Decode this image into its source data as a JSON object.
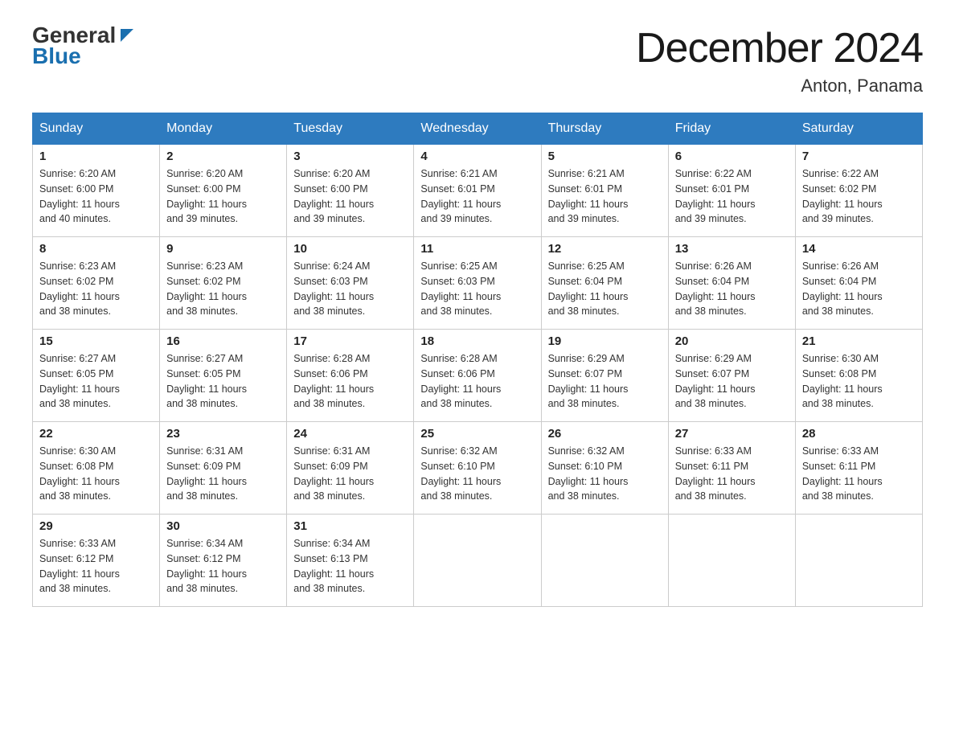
{
  "header": {
    "logo_general": "General",
    "logo_blue": "Blue",
    "month_title": "December 2024",
    "location": "Anton, Panama"
  },
  "days_of_week": [
    "Sunday",
    "Monday",
    "Tuesday",
    "Wednesday",
    "Thursday",
    "Friday",
    "Saturday"
  ],
  "weeks": [
    [
      {
        "day": "1",
        "sunrise": "6:20 AM",
        "sunset": "6:00 PM",
        "daylight": "11 hours and 40 minutes."
      },
      {
        "day": "2",
        "sunrise": "6:20 AM",
        "sunset": "6:00 PM",
        "daylight": "11 hours and 39 minutes."
      },
      {
        "day": "3",
        "sunrise": "6:20 AM",
        "sunset": "6:00 PM",
        "daylight": "11 hours and 39 minutes."
      },
      {
        "day": "4",
        "sunrise": "6:21 AM",
        "sunset": "6:01 PM",
        "daylight": "11 hours and 39 minutes."
      },
      {
        "day": "5",
        "sunrise": "6:21 AM",
        "sunset": "6:01 PM",
        "daylight": "11 hours and 39 minutes."
      },
      {
        "day": "6",
        "sunrise": "6:22 AM",
        "sunset": "6:01 PM",
        "daylight": "11 hours and 39 minutes."
      },
      {
        "day": "7",
        "sunrise": "6:22 AM",
        "sunset": "6:02 PM",
        "daylight": "11 hours and 39 minutes."
      }
    ],
    [
      {
        "day": "8",
        "sunrise": "6:23 AM",
        "sunset": "6:02 PM",
        "daylight": "11 hours and 38 minutes."
      },
      {
        "day": "9",
        "sunrise": "6:23 AM",
        "sunset": "6:02 PM",
        "daylight": "11 hours and 38 minutes."
      },
      {
        "day": "10",
        "sunrise": "6:24 AM",
        "sunset": "6:03 PM",
        "daylight": "11 hours and 38 minutes."
      },
      {
        "day": "11",
        "sunrise": "6:25 AM",
        "sunset": "6:03 PM",
        "daylight": "11 hours and 38 minutes."
      },
      {
        "day": "12",
        "sunrise": "6:25 AM",
        "sunset": "6:04 PM",
        "daylight": "11 hours and 38 minutes."
      },
      {
        "day": "13",
        "sunrise": "6:26 AM",
        "sunset": "6:04 PM",
        "daylight": "11 hours and 38 minutes."
      },
      {
        "day": "14",
        "sunrise": "6:26 AM",
        "sunset": "6:04 PM",
        "daylight": "11 hours and 38 minutes."
      }
    ],
    [
      {
        "day": "15",
        "sunrise": "6:27 AM",
        "sunset": "6:05 PM",
        "daylight": "11 hours and 38 minutes."
      },
      {
        "day": "16",
        "sunrise": "6:27 AM",
        "sunset": "6:05 PM",
        "daylight": "11 hours and 38 minutes."
      },
      {
        "day": "17",
        "sunrise": "6:28 AM",
        "sunset": "6:06 PM",
        "daylight": "11 hours and 38 minutes."
      },
      {
        "day": "18",
        "sunrise": "6:28 AM",
        "sunset": "6:06 PM",
        "daylight": "11 hours and 38 minutes."
      },
      {
        "day": "19",
        "sunrise": "6:29 AM",
        "sunset": "6:07 PM",
        "daylight": "11 hours and 38 minutes."
      },
      {
        "day": "20",
        "sunrise": "6:29 AM",
        "sunset": "6:07 PM",
        "daylight": "11 hours and 38 minutes."
      },
      {
        "day": "21",
        "sunrise": "6:30 AM",
        "sunset": "6:08 PM",
        "daylight": "11 hours and 38 minutes."
      }
    ],
    [
      {
        "day": "22",
        "sunrise": "6:30 AM",
        "sunset": "6:08 PM",
        "daylight": "11 hours and 38 minutes."
      },
      {
        "day": "23",
        "sunrise": "6:31 AM",
        "sunset": "6:09 PM",
        "daylight": "11 hours and 38 minutes."
      },
      {
        "day": "24",
        "sunrise": "6:31 AM",
        "sunset": "6:09 PM",
        "daylight": "11 hours and 38 minutes."
      },
      {
        "day": "25",
        "sunrise": "6:32 AM",
        "sunset": "6:10 PM",
        "daylight": "11 hours and 38 minutes."
      },
      {
        "day": "26",
        "sunrise": "6:32 AM",
        "sunset": "6:10 PM",
        "daylight": "11 hours and 38 minutes."
      },
      {
        "day": "27",
        "sunrise": "6:33 AM",
        "sunset": "6:11 PM",
        "daylight": "11 hours and 38 minutes."
      },
      {
        "day": "28",
        "sunrise": "6:33 AM",
        "sunset": "6:11 PM",
        "daylight": "11 hours and 38 minutes."
      }
    ],
    [
      {
        "day": "29",
        "sunrise": "6:33 AM",
        "sunset": "6:12 PM",
        "daylight": "11 hours and 38 minutes."
      },
      {
        "day": "30",
        "sunrise": "6:34 AM",
        "sunset": "6:12 PM",
        "daylight": "11 hours and 38 minutes."
      },
      {
        "day": "31",
        "sunrise": "6:34 AM",
        "sunset": "6:13 PM",
        "daylight": "11 hours and 38 minutes."
      },
      null,
      null,
      null,
      null
    ]
  ],
  "labels": {
    "sunrise": "Sunrise:",
    "sunset": "Sunset:",
    "daylight": "Daylight:"
  }
}
